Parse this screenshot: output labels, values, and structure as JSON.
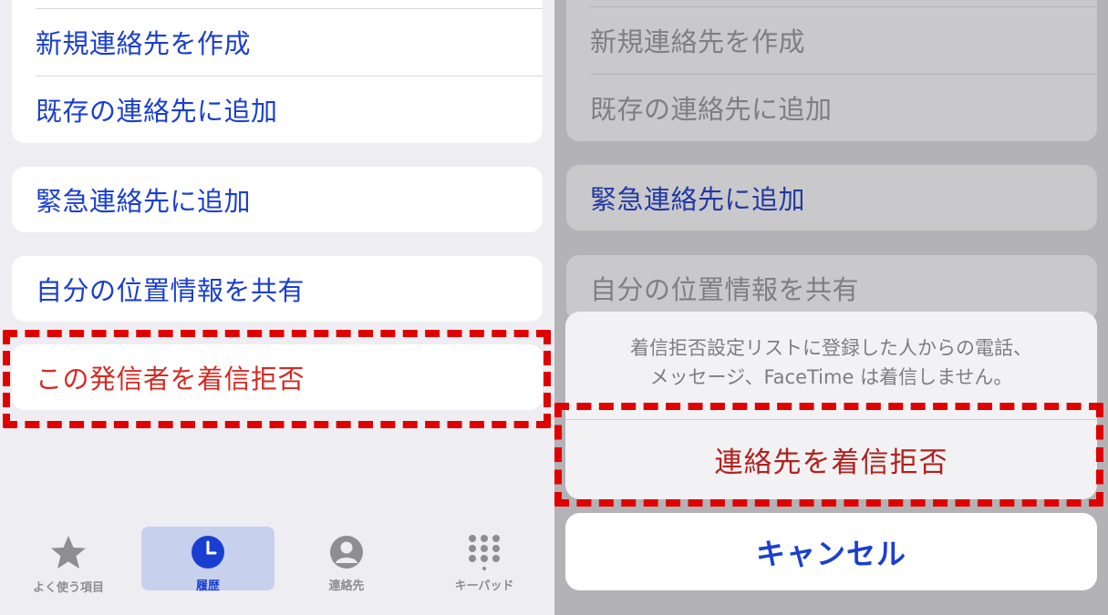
{
  "left": {
    "menu_group1": {
      "items": [
        {
          "label": "新規連絡先を作成"
        },
        {
          "label": "既存の連絡先に追加"
        }
      ]
    },
    "emergency_label": "緊急連絡先に追加",
    "share_location_label": "自分の位置情報を共有",
    "block_caller_label": "この発信者を着信拒否",
    "tabbar": {
      "tabs": [
        {
          "label": "よく使う項目",
          "icon": "star-icon",
          "active": false
        },
        {
          "label": "履歴",
          "icon": "clock-icon",
          "active": true
        },
        {
          "label": "連絡先",
          "icon": "person-circle-icon",
          "active": false
        },
        {
          "label": "キーパッド",
          "icon": "keypad-icon",
          "active": false
        }
      ]
    }
  },
  "right": {
    "menu_group1": {
      "items": [
        {
          "label": "新規連絡先を作成"
        },
        {
          "label": "既存の連絡先に追加"
        }
      ]
    },
    "emergency_label": "緊急連絡先に追加",
    "share_location_label": "自分の位置情報を共有",
    "action_sheet": {
      "message_line1": "着信拒否設定リストに登録した人からの電話、",
      "message_line2": "メッセージ、FaceTime は着信しません。",
      "block_contact_label": "連絡先を着信拒否",
      "cancel_label": "キャンセル"
    }
  },
  "colors": {
    "link_blue": "#1a3fd0",
    "destructive_red": "#d42a23",
    "highlight_dash": "#e00000"
  }
}
